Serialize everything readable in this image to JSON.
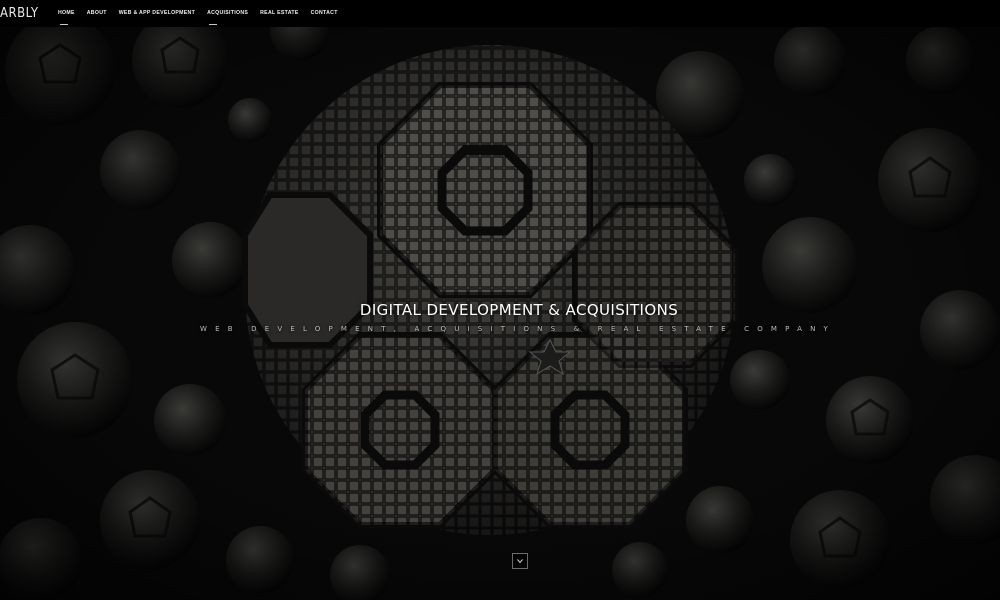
{
  "brand": {
    "logo_text": "ARBLY"
  },
  "nav": {
    "items": [
      {
        "label": "HOME",
        "active": true
      },
      {
        "label": "ABOUT"
      },
      {
        "label": "WEB & APP DEVELOPMENT"
      },
      {
        "label": "ACQUISITIONS",
        "underlined": true
      },
      {
        "label": "REAL ESTATE"
      },
      {
        "label": "CONTACT"
      }
    ]
  },
  "hero": {
    "title": "DIGITAL DEVELOPMENT & ACQUISITIONS",
    "subtitle": "WEB DEVELOPMENT, ACQUISITIONS & REAL ESTATE COMPANY",
    "scroll_icon": "chevron-down-icon"
  },
  "colors": {
    "background": "#000000",
    "text": "#ffffff",
    "subtitle": "#bdbdbd"
  }
}
